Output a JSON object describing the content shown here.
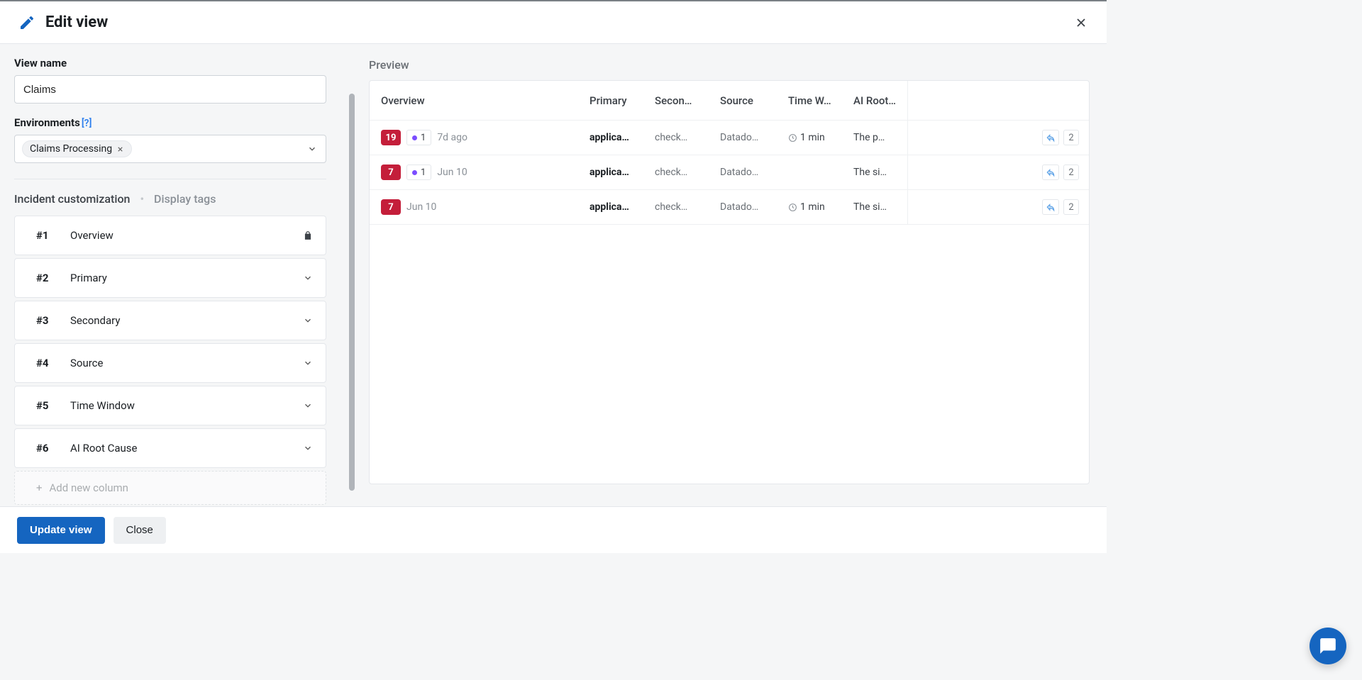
{
  "header": {
    "title": "Edit view"
  },
  "form": {
    "view_name_label": "View name",
    "view_name_value": "Claims",
    "environments_label": "Environments",
    "environments_help": "[?]",
    "environment_chip": "Claims Processing"
  },
  "customization": {
    "tab_active": "Incident customization",
    "tab_inactive": "Display tags",
    "columns": [
      {
        "idx": "#1",
        "name": "Overview",
        "locked": true
      },
      {
        "idx": "#2",
        "name": "Primary",
        "locked": false
      },
      {
        "idx": "#3",
        "name": "Secondary",
        "locked": false
      },
      {
        "idx": "#4",
        "name": "Source",
        "locked": false
      },
      {
        "idx": "#5",
        "name": "Time Window",
        "locked": false
      },
      {
        "idx": "#6",
        "name": "AI Root Cause",
        "locked": false
      }
    ],
    "add_label": "Add new column"
  },
  "preview": {
    "label": "Preview",
    "headers": {
      "overview": "Overview",
      "primary": "Primary",
      "secondary": "Secon…",
      "source": "Source",
      "timew": "Time W…",
      "root": "AI Root…"
    },
    "rows": [
      {
        "count": "19",
        "sub": "1",
        "has_sub": true,
        "time": "7d ago",
        "primary": "applica…",
        "secondary": "check…",
        "source": "Datado…",
        "timew": "1 min",
        "has_timew": true,
        "root": "The p…",
        "share_count": "2"
      },
      {
        "count": "7",
        "sub": "1",
        "has_sub": true,
        "time": "Jun 10",
        "primary": "applica…",
        "secondary": "check…",
        "source": "Datado…",
        "timew": "",
        "has_timew": false,
        "root": "The si…",
        "share_count": "2"
      },
      {
        "count": "7",
        "sub": "",
        "has_sub": false,
        "time": "Jun 10",
        "primary": "applica…",
        "secondary": "check…",
        "source": "Datado…",
        "timew": "1 min",
        "has_timew": true,
        "root": "The si…",
        "share_count": "2"
      }
    ]
  },
  "footer": {
    "update": "Update view",
    "close": "Close"
  }
}
